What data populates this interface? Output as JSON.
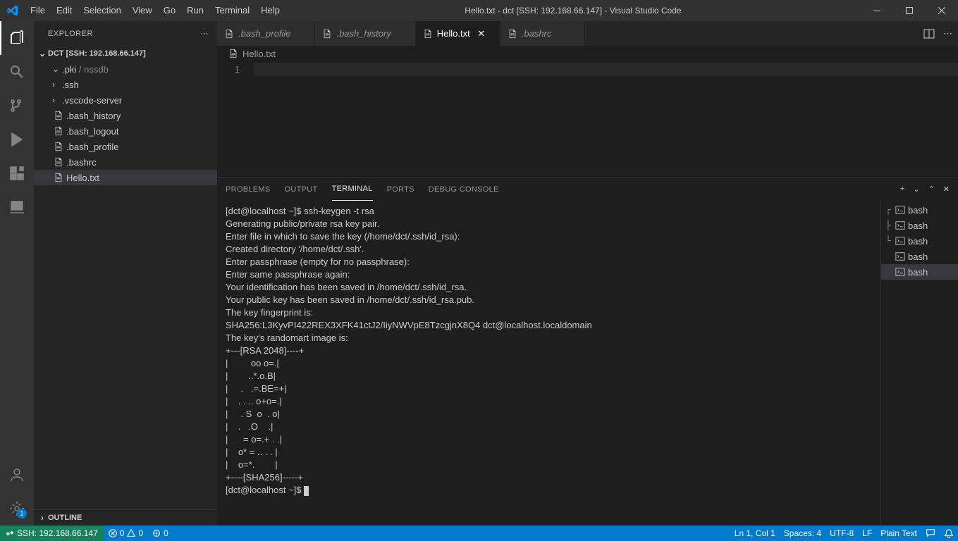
{
  "titlebar": {
    "title": "Hello.txt - dct [SSH: 192.168.66.147] - Visual Studio Code",
    "menu": [
      "File",
      "Edit",
      "Selection",
      "View",
      "Go",
      "Run",
      "Terminal",
      "Help"
    ]
  },
  "activitybar": {
    "settings_badge": "1"
  },
  "sidebar": {
    "title": "EXPLORER",
    "root_label": "DCT [SSH: 192.168.66.147]",
    "tree": [
      {
        "type": "folder",
        "expanded": true,
        "label": ".pki",
        "sublabel": "nssdb"
      },
      {
        "type": "folder",
        "expanded": false,
        "label": ".ssh"
      },
      {
        "type": "folder",
        "expanded": false,
        "label": ".vscode-server"
      },
      {
        "type": "file",
        "label": ".bash_history"
      },
      {
        "type": "file",
        "label": ".bash_logout"
      },
      {
        "type": "file",
        "label": ".bash_profile"
      },
      {
        "type": "file",
        "label": ".bashrc"
      },
      {
        "type": "file",
        "label": "Hello.txt",
        "selected": true
      }
    ],
    "outline_label": "OUTLINE"
  },
  "tabs": [
    {
      "label": ".bash_profile",
      "active": false,
      "italic": true
    },
    {
      "label": ".bash_history",
      "active": false,
      "italic": true
    },
    {
      "label": "Hello.txt",
      "active": true,
      "italic": false
    },
    {
      "label": ".bashrc",
      "active": false,
      "italic": true
    }
  ],
  "breadcrumb": {
    "file": "Hello.txt"
  },
  "editor": {
    "line_number": "1"
  },
  "panel": {
    "tabs": [
      "PROBLEMS",
      "OUTPUT",
      "TERMINAL",
      "PORTS",
      "DEBUG CONSOLE"
    ],
    "active_tab": "TERMINAL",
    "terminals": [
      {
        "prefix": "┌",
        "label": "bash"
      },
      {
        "prefix": "├",
        "label": "bash"
      },
      {
        "prefix": "└",
        "label": "bash"
      },
      {
        "prefix": "",
        "label": "bash"
      },
      {
        "prefix": "",
        "label": "bash",
        "active": true
      }
    ],
    "output": "[dct@localhost ~]$ ssh-keygen -t rsa\nGenerating public/private rsa key pair.\nEnter file in which to save the key (/home/dct/.ssh/id_rsa):\nCreated directory '/home/dct/.ssh'.\nEnter passphrase (empty for no passphrase):\nEnter same passphrase again:\nYour identification has been saved in /home/dct/.ssh/id_rsa.\nYour public key has been saved in /home/dct/.ssh/id_rsa.pub.\nThe key fingerprint is:\nSHA256:L3KyvPI422REX3XFK41ctJ2/IiyNWVpE8TzcgjnX8Q4 dct@localhost.localdomain\nThe key's randomart image is:\n+---[RSA 2048]----+\n|         oo o=.|\n|        ..*.o.B|\n|     .   .=.BE=+|\n|    . . .. o+o=.|\n|     . S  o  . o|\n|    .   .O    .|\n|      = o=.+ . .|\n|    o* = .. . . |\n|    o=*.        |\n+----[SHA256]-----+\n[dct@localhost ~]$ "
  },
  "statusbar": {
    "remote": "SSH: 192.168.66.147",
    "errors": "0",
    "warnings": "0",
    "ports": "0",
    "ln_col": "Ln 1, Col 1",
    "spaces": "Spaces: 4",
    "encoding": "UTF-8",
    "eol": "LF",
    "lang": "Plain Text"
  }
}
